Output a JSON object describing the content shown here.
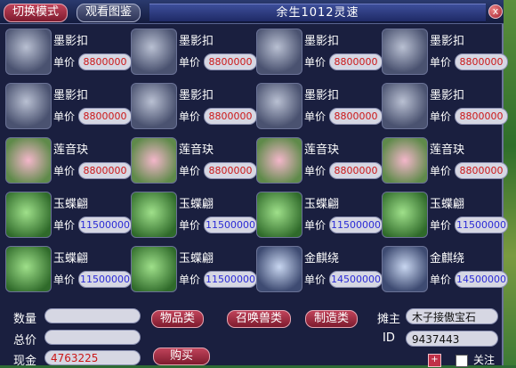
{
  "header": {
    "mode_button": "切换模式",
    "catalog_button": "观看图鉴",
    "shop_title": "余生1012灵速",
    "close": "x"
  },
  "items": [
    {
      "name": "墨影扣",
      "price_label": "单价",
      "price": "8800000",
      "price_color": "red",
      "icon": "ring-icon"
    },
    {
      "name": "墨影扣",
      "price_label": "单价",
      "price": "8800000",
      "price_color": "red",
      "icon": "ring-icon"
    },
    {
      "name": "墨影扣",
      "price_label": "单价",
      "price": "8800000",
      "price_color": "red",
      "icon": "ring-icon"
    },
    {
      "name": "墨影扣",
      "price_label": "单价",
      "price": "8800000",
      "price_color": "red",
      "icon": "ring-icon"
    },
    {
      "name": "墨影扣",
      "price_label": "单价",
      "price": "8800000",
      "price_color": "red",
      "icon": "ring-icon"
    },
    {
      "name": "墨影扣",
      "price_label": "单价",
      "price": "8800000",
      "price_color": "red",
      "icon": "ring-icon"
    },
    {
      "name": "墨影扣",
      "price_label": "单价",
      "price": "8800000",
      "price_color": "red",
      "icon": "ring-icon"
    },
    {
      "name": "墨影扣",
      "price_label": "单价",
      "price": "8800000",
      "price_color": "red",
      "icon": "ring-icon"
    },
    {
      "name": "莲音玦",
      "price_label": "单价",
      "price": "8800000",
      "price_color": "red",
      "icon": "lotus-icon"
    },
    {
      "name": "莲音玦",
      "price_label": "单价",
      "price": "8800000",
      "price_color": "red",
      "icon": "lotus-icon"
    },
    {
      "name": "莲音玦",
      "price_label": "单价",
      "price": "8800000",
      "price_color": "red",
      "icon": "lotus-icon"
    },
    {
      "name": "莲音玦",
      "price_label": "单价",
      "price": "8800000",
      "price_color": "red",
      "icon": "lotus-icon"
    },
    {
      "name": "玉蝶翩",
      "price_label": "单价",
      "price": "11500000",
      "price_color": "blue",
      "icon": "jade-icon"
    },
    {
      "name": "玉蝶翩",
      "price_label": "单价",
      "price": "11500000",
      "price_color": "blue",
      "icon": "jade-icon"
    },
    {
      "name": "玉蝶翩",
      "price_label": "单价",
      "price": "11500000",
      "price_color": "blue",
      "icon": "jade-icon"
    },
    {
      "name": "玉蝶翩",
      "price_label": "单价",
      "price": "11500000",
      "price_color": "blue",
      "icon": "jade-icon"
    },
    {
      "name": "玉蝶翩",
      "price_label": "单价",
      "price": "11500000",
      "price_color": "blue",
      "icon": "jade-icon"
    },
    {
      "name": "玉蝶翩",
      "price_label": "单价",
      "price": "11500000",
      "price_color": "blue",
      "icon": "jade-icon"
    },
    {
      "name": "金麒绕",
      "price_label": "单价",
      "price": "14500000",
      "price_color": "blue",
      "icon": "qilin-icon"
    },
    {
      "name": "金麒绕",
      "price_label": "单价",
      "price": "14500000",
      "price_color": "blue",
      "icon": "qilin-icon"
    }
  ],
  "form": {
    "quantity_label": "数量",
    "total_label": "总价",
    "cash_label": "现金",
    "cash_value": "4763225",
    "buy_button": "购买"
  },
  "categories": [
    "物品类",
    "召唤兽类",
    "制造类"
  ],
  "seller": {
    "owner_label": "摊主",
    "owner_value": "木子接傲宝石",
    "id_label": "ID",
    "id_value": "9437443",
    "plus": "+",
    "follow_label": "关注"
  },
  "colors": {
    "price_red": "#cc1717",
    "price_blue": "#2b2bd6",
    "accent_button": "#9e2a3e"
  }
}
